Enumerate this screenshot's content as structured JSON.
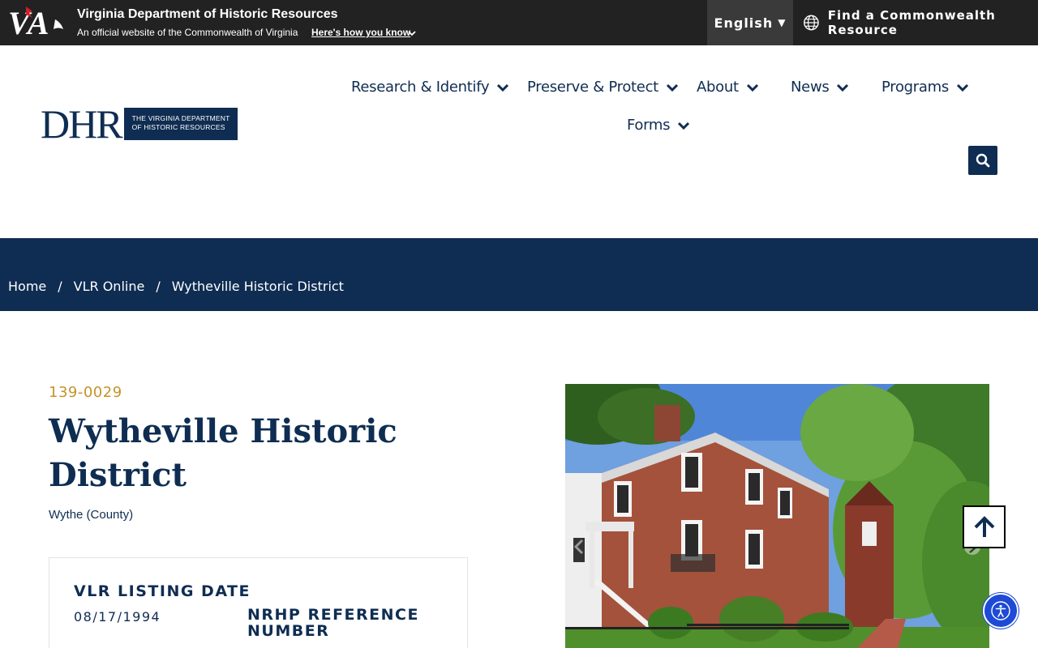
{
  "banner": {
    "logo_text": "VA",
    "agency": "Virginia Department of Historic Resources",
    "official": "An official website of the Commonwealth of Virginia",
    "howto": "Here's how you know",
    "language": "English",
    "find_resource": "Find a Commonwealth Resource"
  },
  "header": {
    "logo_letters": "DHR",
    "logo_line1": "THE VIRGINIA DEPARTMENT",
    "logo_line2": "OF HISTORIC RESOURCES",
    "nav": [
      {
        "label": "Research & Identify"
      },
      {
        "label": "Preserve & Protect"
      },
      {
        "label": "About"
      },
      {
        "label": "News"
      },
      {
        "label": "Programs"
      },
      {
        "label": "Forms"
      }
    ]
  },
  "breadcrumb": {
    "items": [
      "Home",
      "VLR Online",
      "Wytheville Historic District"
    ],
    "separator": "/"
  },
  "listing": {
    "reference": "139-0029",
    "title": "Wytheville Historic District",
    "county": "Wythe (County)",
    "vlr_label": "VLR LISTING DATE",
    "vlr_value": "08/17/1994",
    "nrhp_label_1": "NRHP REFERENCE",
    "nrhp_label_2": "NUMBER"
  },
  "colors": {
    "navy": "#0f2d52",
    "gold": "#c4942a",
    "banner": "#222222",
    "accessibility": "#1d4ad6"
  }
}
